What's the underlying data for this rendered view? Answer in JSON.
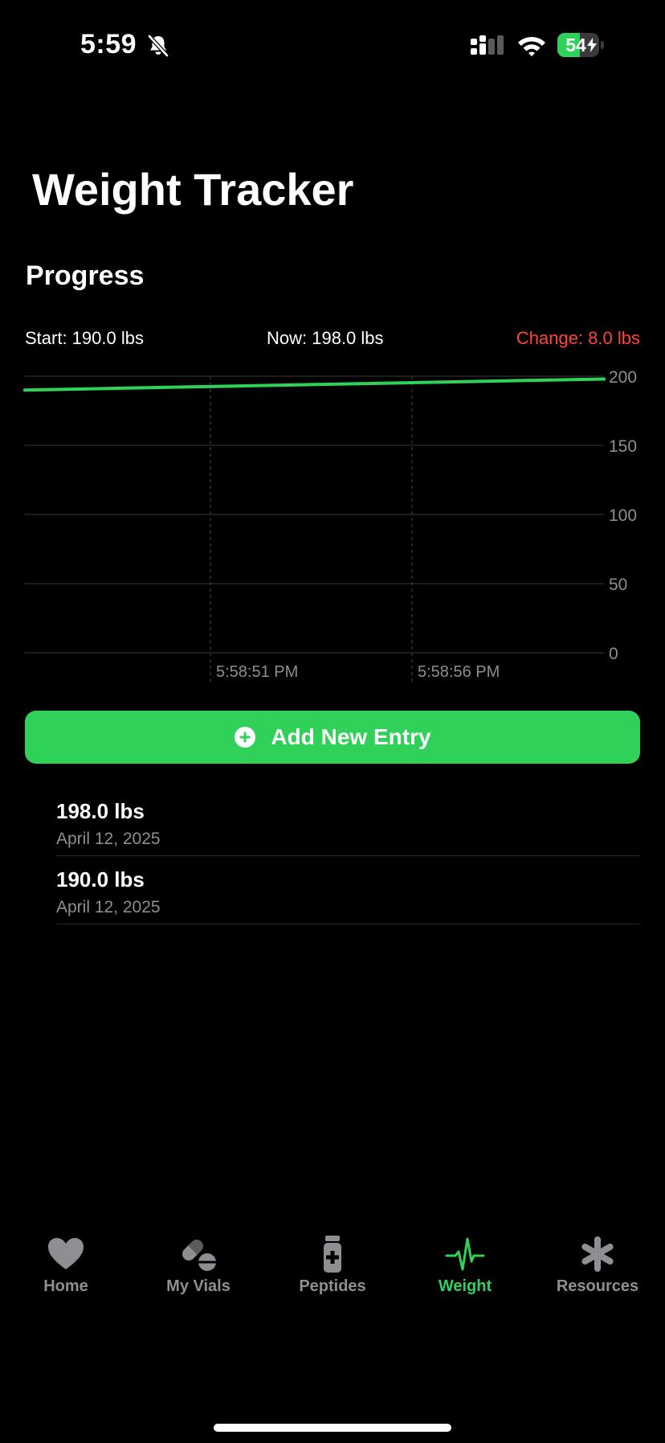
{
  "status_bar": {
    "time": "5:59",
    "battery_level": "54",
    "battery_fraction": 0.54
  },
  "title": "Weight Tracker",
  "progress": {
    "title": "Progress",
    "start_label": "Start: 190.0 lbs",
    "now_label": "Now: 198.0 lbs",
    "change_label": "Change: 8.0 lbs",
    "change_color": "#ff453a"
  },
  "chart_data": {
    "type": "line",
    "x": [
      "5:58:46 PM",
      "5:59:00 PM"
    ],
    "y": [
      190.0,
      198.0
    ],
    "x_tick_labels": [
      "5:58:51 PM",
      "5:58:56 PM"
    ],
    "y_ticks": [
      0,
      50,
      100,
      150,
      200
    ],
    "ylim": [
      0,
      200
    ],
    "grid": true,
    "line_color": "#30d158"
  },
  "add_button": {
    "label": "Add New Entry"
  },
  "entries": [
    {
      "weight": "198.0 lbs",
      "date": "April 12, 2025"
    },
    {
      "weight": "190.0 lbs",
      "date": "April 12, 2025"
    }
  ],
  "tabs": [
    {
      "label": "Home",
      "icon": "heart-icon"
    },
    {
      "label": "My Vials",
      "icon": "pills-icon"
    },
    {
      "label": "Peptides",
      "icon": "medicine-bottle-icon"
    },
    {
      "label": "Weight",
      "icon": "waveform-pulse-icon",
      "active": true
    },
    {
      "label": "Resources",
      "icon": "asterisk-icon"
    }
  ],
  "colors": {
    "accent": "#30d158",
    "background": "#000000",
    "muted": "#8e8e93"
  }
}
